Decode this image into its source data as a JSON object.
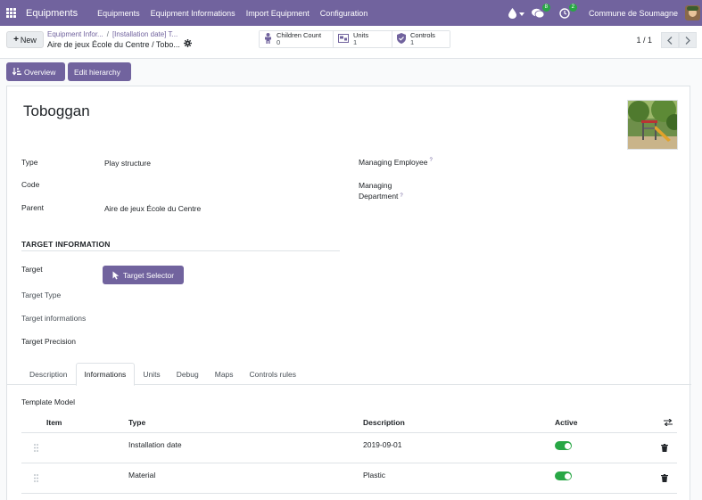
{
  "navbar": {
    "brand": "Equipments",
    "menu": [
      "Equipments",
      "Equipment Informations",
      "Import Equipment",
      "Configuration"
    ],
    "messages_count": "8",
    "activities_count": "2",
    "company": "Commune de Soumagne"
  },
  "control": {
    "new_label": "New",
    "breadcrumb": {
      "crumb1": "Equipment Infor...",
      "crumb2": "[Installation date] T...",
      "current": "Aire de jeux École du Centre / Tobo..."
    },
    "smart_buttons": [
      {
        "label": "Children Count",
        "value": "0",
        "icon": "child-icon"
      },
      {
        "label": "Units",
        "value": "1",
        "icon": "units-icon"
      },
      {
        "label": "Controls",
        "value": "1",
        "icon": "shield-check-icon"
      }
    ],
    "pager": "1 / 1"
  },
  "status_buttons": {
    "overview": "Overview",
    "edit_hierarchy": "Edit hierarchy"
  },
  "form": {
    "title": "Toboggan",
    "type_label": "Type",
    "type_value": "Play structure",
    "code_label": "Code",
    "code_value": "",
    "parent_label": "Parent",
    "parent_value": "Aire de jeux École du Centre",
    "managing_employee_label": "Managing Employee",
    "managing_department_label_1": "Managing",
    "managing_department_label_2": "Department",
    "help_mark": "?",
    "target_section": "TARGET INFORMATION",
    "target_label": "Target",
    "target_button": "Target Selector",
    "target_type_label": "Target Type",
    "target_informations_label": "Target informations",
    "target_precision_label": "Target Precision"
  },
  "tabs": [
    "Description",
    "Informations",
    "Units",
    "Debug",
    "Maps",
    "Controls rules"
  ],
  "active_tab": "Informations",
  "template_model_label": "Template Model",
  "table": {
    "headers": {
      "item": "Item",
      "type": "Type",
      "description": "Description",
      "active": "Active"
    },
    "rows": [
      {
        "item": "",
        "type": "Installation date",
        "description": "2019-09-01",
        "active": true
      },
      {
        "item": "",
        "type": "Material",
        "description": "Plastic",
        "active": true
      }
    ]
  },
  "colors": {
    "brand": "#71639e",
    "toggle_on": "#28a745"
  }
}
